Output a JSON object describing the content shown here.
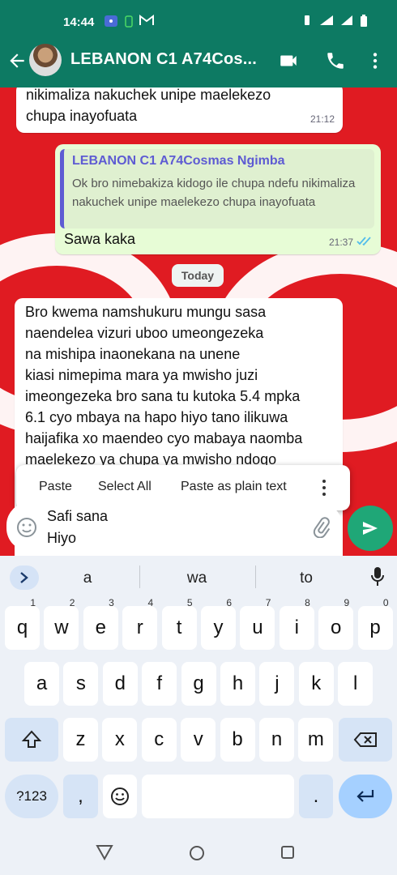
{
  "status_bar": {
    "time": "14:44"
  },
  "header": {
    "title": "LEBANON C1 A74Cos..."
  },
  "messages": {
    "m1": {
      "text_line1": "nikimaliza nakuchek unipe maelekezo",
      "text_line2": "chupa inayofuata",
      "time": "21:12"
    },
    "m2": {
      "quote_name": "LEBANON C1 A74Cosmas Ngimba",
      "quote_text": "Ok bro nimebakiza kidogo ile chupa ndefu nikimaliza nakuchek unipe maelekezo chupa inayofuata",
      "text": "Sawa kaka",
      "time": "21:37"
    },
    "date_divider": "Today",
    "m3": {
      "lines": [
        "Bro kwema namshukuru mungu sasa",
        "naendelea vizuri uboo umeongezeka",
        "na mishipa inaonekana na unene",
        "kiasi nimepima mara ya mwisho juzi",
        "imeongezeka bro sana tu kutoka 5.4 mpka",
        "6.1 cyo mbaya na hapo hiyo tano ilikuwa",
        "haijafika xo maendeo cyo mabaya naomba",
        "maelekezo ya chupa ya mwisho ndogo"
      ]
    }
  },
  "context_menu": {
    "paste": "Paste",
    "select_all": "Select All",
    "paste_plain": "Paste as plain text"
  },
  "composer": {
    "draft_line1": "Safi sana",
    "draft_line2": "Hiyo"
  },
  "keyboard": {
    "suggestions": [
      "a",
      "wa",
      "to"
    ],
    "row1": [
      {
        "k": "q",
        "h": "1"
      },
      {
        "k": "w",
        "h": "2"
      },
      {
        "k": "e",
        "h": "3"
      },
      {
        "k": "r",
        "h": "4"
      },
      {
        "k": "t",
        "h": "5"
      },
      {
        "k": "y",
        "h": "6"
      },
      {
        "k": "u",
        "h": "7"
      },
      {
        "k": "i",
        "h": "8"
      },
      {
        "k": "o",
        "h": "9"
      },
      {
        "k": "p",
        "h": "0"
      }
    ],
    "row2": [
      "a",
      "s",
      "d",
      "f",
      "g",
      "h",
      "j",
      "k",
      "l"
    ],
    "row3": [
      "z",
      "x",
      "c",
      "v",
      "b",
      "n",
      "m"
    ],
    "symbols": "?123",
    "comma": ",",
    "period": "."
  },
  "colors": {
    "header": "#0d7a63",
    "chat_bg": "#e01b22",
    "outgoing": "#e7fcd6",
    "send": "#1fa777",
    "quote_accent": "#5e5bd3"
  }
}
